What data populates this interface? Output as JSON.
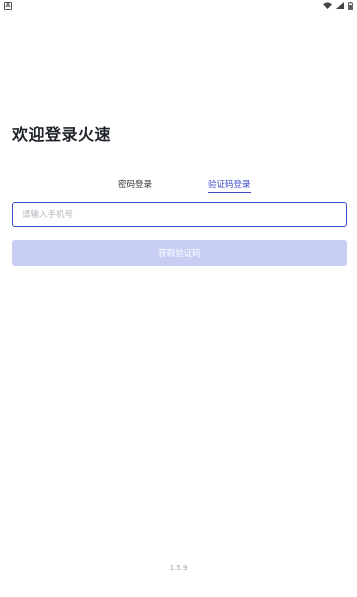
{
  "status_bar": {
    "notification_icon_letter": "A",
    "icons": [
      "wifi-icon",
      "signal-icon",
      "battery-icon"
    ]
  },
  "login": {
    "title": "欢迎登录火速",
    "tabs": [
      {
        "label": "密码登录",
        "active": false
      },
      {
        "label": "验证码登录",
        "active": true
      }
    ],
    "phone_placeholder": "请输入手机号",
    "phone_value": "",
    "get_code_label": "获取验证码"
  },
  "footer": {
    "version": "1.5.9"
  },
  "colors": {
    "accent": "#3a4cc9",
    "button_disabled": "#c7cdf3",
    "title": "#1f2329"
  }
}
